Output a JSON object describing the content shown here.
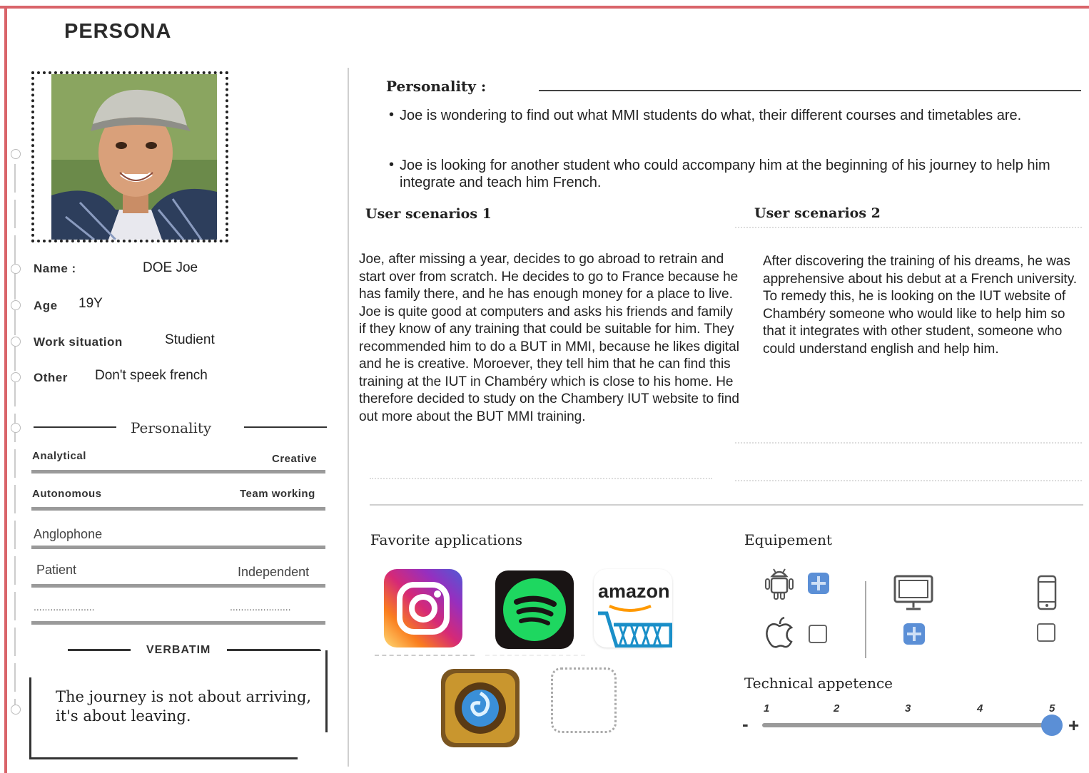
{
  "header": {
    "title": "PERSONA"
  },
  "profile": {
    "name_label": "Name :",
    "name_value": "DOE Joe",
    "age_label": "Age",
    "age_value": "19Y",
    "work_label": "Work situation",
    "work_value": "Studient",
    "other_label": "Other",
    "other_value": "Don't speek french"
  },
  "personality_traits": {
    "heading": "Personality",
    "rows": [
      {
        "left": "Analytical",
        "right": "Creative"
      },
      {
        "left": "Autonomous",
        "right": "Team working"
      },
      {
        "left": "Anglophone",
        "right": ""
      },
      {
        "left": "Patient",
        "right": "Independent"
      },
      {
        "left": "......................",
        "right": "......................"
      }
    ]
  },
  "verbatim": {
    "heading": "VERBATIM",
    "quote_line1": "The journey is not about arriving,",
    "quote_line2": "it's about leaving."
  },
  "personality": {
    "heading": "Personality :",
    "bullets": [
      "Joe is wondering to find out what MMI students do what, their different courses and timetables are.",
      "Joe is looking for another student who could accompany him at the beginning of his journey to help him integrate and teach him French."
    ]
  },
  "scenarios": {
    "s1_heading": "User scenarios 1",
    "s1_text": "Joe, after missing a year, decides to go abroad to retrain and start over from scratch. He decides to go to France because he has family there, and he has enough money for a place to live. Joe is quite good at computers and asks his friends and family if they know of any training that could be suitable for him. They recommended him to do a BUT in MMI, because he likes digital and he is creative. Moroever, they tell him that he can find this training at the IUT in Chambéry which is close to his home. He therefore decided to study on the Chambery IUT website to find out more about the BUT MMI training.",
    "s2_heading": "User scenarios 2",
    "s2_text": "After discovering the training of his dreams, he was apprehensive about his debut at a French university. To remedy this, he is looking on the IUT website of Chambéry someone who would like to help him so that it integrates with other student, someone who could understand english and help him."
  },
  "apps": {
    "heading": "Favorite applications",
    "items": [
      {
        "icon": "instagram-icon",
        "color": "#d62976"
      },
      {
        "icon": "spotify-icon",
        "color": "#1ed760"
      },
      {
        "icon": "amazon-icon",
        "label": "amazon",
        "color": "#ff9900"
      },
      {
        "icon": "hearthstone-icon",
        "color": "#3a8fd8"
      }
    ]
  },
  "equipment": {
    "heading": "Equipement",
    "android_checked": true,
    "apple_checked": false,
    "computer_checked": true,
    "phone_checked": false
  },
  "technical": {
    "heading": "Technical appetence",
    "ticks": [
      "1",
      "2",
      "3",
      "4",
      "5"
    ],
    "minus": "-",
    "plus": "+",
    "value": 5,
    "accent": "#5b8fd6"
  }
}
